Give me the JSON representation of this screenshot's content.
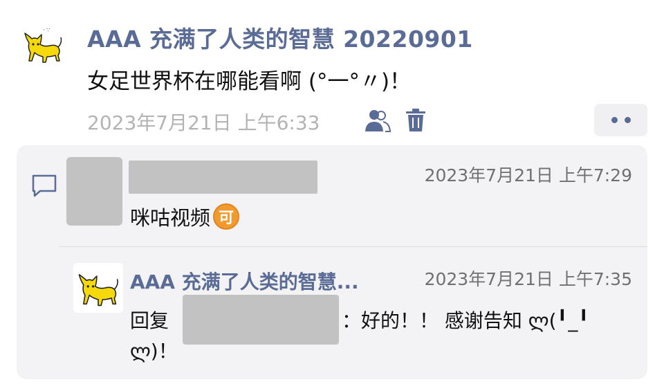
{
  "post": {
    "author": "AAA 充满了人类的智慧 20220901",
    "text": "女足世界杯在哪能看啊 (°一°〃)！",
    "time": "2023年7月21日 上午6:33",
    "avatar_icon": "cat-avatar-icon",
    "visibility_icon": "people-icon",
    "delete_icon": "trash-icon",
    "more_icon": "more-dots-icon"
  },
  "comment": {
    "time": "2023年7月21日 上午7:29",
    "text": "咪咕视频",
    "emoji": "可",
    "icon": "comment-bubble-icon"
  },
  "reply": {
    "author": "AAA 充满了人类的智慧...",
    "time": "2023年7月21日 上午7:35",
    "prefix": "回复",
    "text": "：好的！！ 感谢告知 ლ(╹_╹",
    "text_cont": "ლ)！"
  },
  "colors": {
    "name": "#5a6b95",
    "time": "#b3b3b3",
    "panel": "#f3f3f5",
    "blur": "#c2c2c2"
  }
}
